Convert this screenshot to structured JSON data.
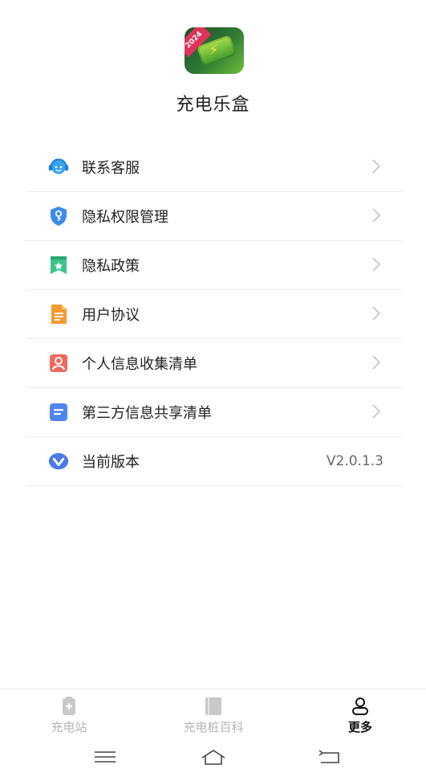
{
  "app": {
    "name": "充电乐盒",
    "icon_badge": "2024"
  },
  "menu": {
    "items": [
      {
        "label": "联系客服",
        "icon": "customer-service-icon",
        "color": "#3aa4f0"
      },
      {
        "label": "隐私权限管理",
        "icon": "shield-key-icon",
        "color": "#3b8cf0"
      },
      {
        "label": "隐私政策",
        "icon": "bookmark-star-icon",
        "color": "#3cc48a"
      },
      {
        "label": "用户协议",
        "icon": "document-icon",
        "color": "#f59a2e"
      },
      {
        "label": "个人信息收集清单",
        "icon": "user-card-icon",
        "color": "#f0675c"
      },
      {
        "label": "第三方信息共享清单",
        "icon": "list-doc-icon",
        "color": "#4e86f0"
      },
      {
        "label": "当前版本",
        "icon": "version-icon",
        "color": "#4a7ae6",
        "value": "V2.0.1.3"
      }
    ]
  },
  "tabbar": {
    "tabs": [
      {
        "label": "充电站",
        "icon": "charging-station-icon",
        "active": false
      },
      {
        "label": "充电桩百科",
        "icon": "book-icon",
        "active": false
      },
      {
        "label": "更多",
        "icon": "person-icon",
        "active": true
      }
    ]
  },
  "colors": {
    "divider": "#ececec",
    "inactive_tab": "#b5b5b5",
    "active_tab": "#111111"
  }
}
